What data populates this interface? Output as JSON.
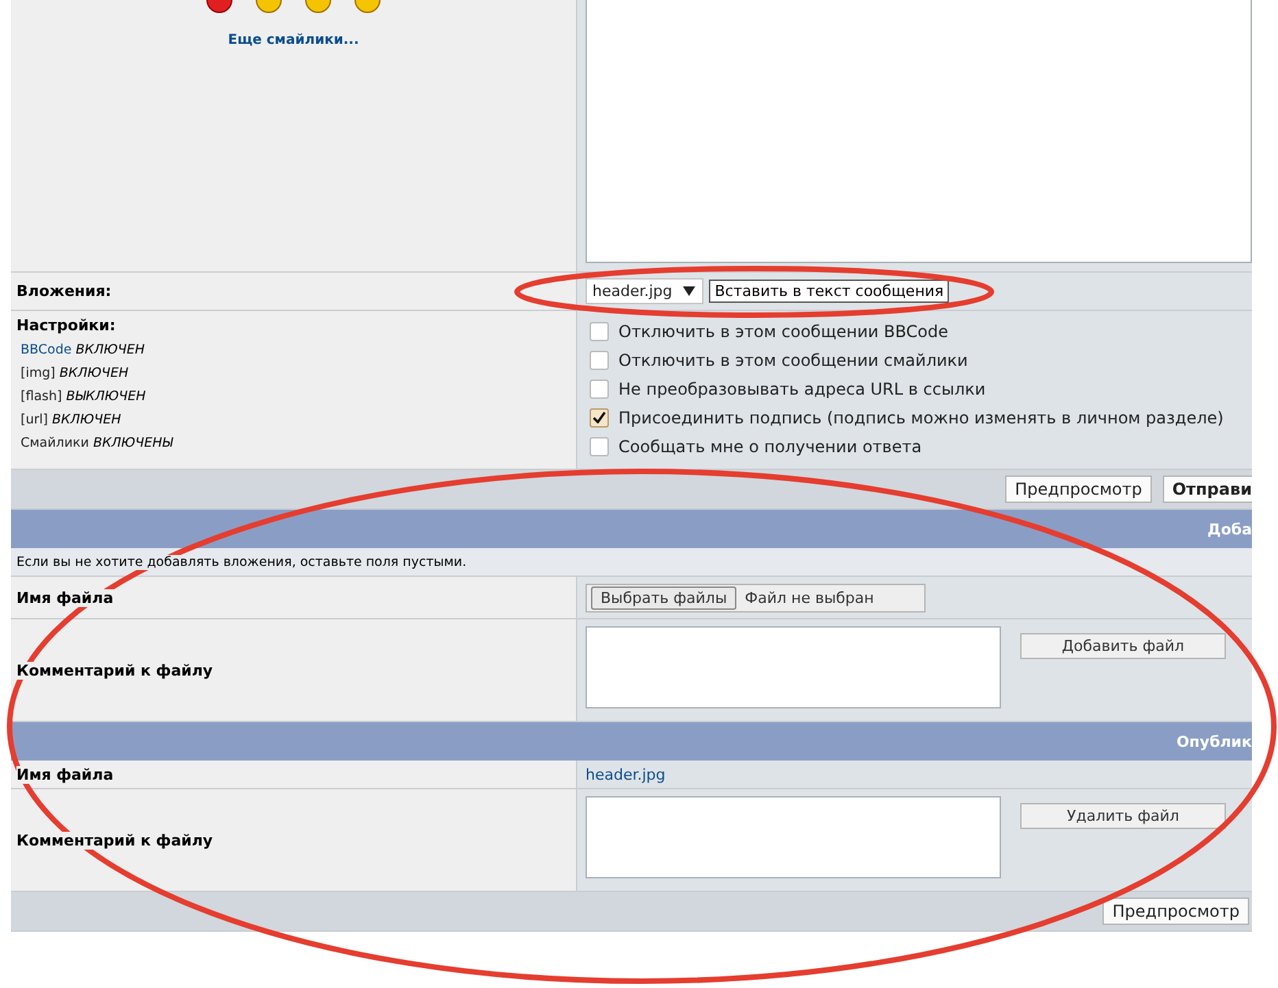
{
  "smilies": {
    "more_link": "Еще смайлики..."
  },
  "attachments_row": {
    "label": "Вложения:",
    "select_value": "header.jpg",
    "insert_button": "Вставить в текст сообщения"
  },
  "settings": {
    "label": "Настройки:",
    "items": [
      {
        "name": "BBCode",
        "state": "ВКЛЮЧЕН",
        "link": true
      },
      {
        "name": "[img]",
        "state": "ВКЛЮЧЕН",
        "link": false
      },
      {
        "name": "[flash]",
        "state": "ВЫКЛЮЧЕН",
        "link": false
      },
      {
        "name": "[url]",
        "state": "ВКЛЮЧЕН",
        "link": false
      },
      {
        "name": "Смайлики",
        "state": "ВКЛЮЧЕНЫ",
        "link": false
      }
    ],
    "options": [
      {
        "label": "Отключить в этом сообщении BBCode",
        "checked": false
      },
      {
        "label": "Отключить в этом сообщении смайлики",
        "checked": false
      },
      {
        "label": "Не преобразовывать адреса URL в ссылки",
        "checked": false
      },
      {
        "label": "Присоединить подпись (подпись можно изменять в личном разделе)",
        "checked": true
      },
      {
        "label": "Сообщать мне о получении ответа",
        "checked": false
      }
    ]
  },
  "buttons": [
    {
      "label": "Предпросмотр",
      "kind": "normal"
    },
    {
      "label": "Отправи",
      "kind": "primary"
    }
  ],
  "add_section": {
    "title": "Доба",
    "hint": "Если вы не хотите добавлять вложения, оставьте поля пустыми.",
    "file_label": "Имя файла",
    "choose_button": "Выбрать файлы",
    "no_file": "Файл не выбран",
    "comment_label": "Комментарий к файлу",
    "add_button": "Добавить файл"
  },
  "posted_section": {
    "title": "Опублик",
    "file_label": "Имя файла",
    "file_name": "header.jpg",
    "comment_label": "Комментарий к файлу",
    "delete_button": "Удалить файл"
  },
  "bottom_button": "Предпросмотр"
}
